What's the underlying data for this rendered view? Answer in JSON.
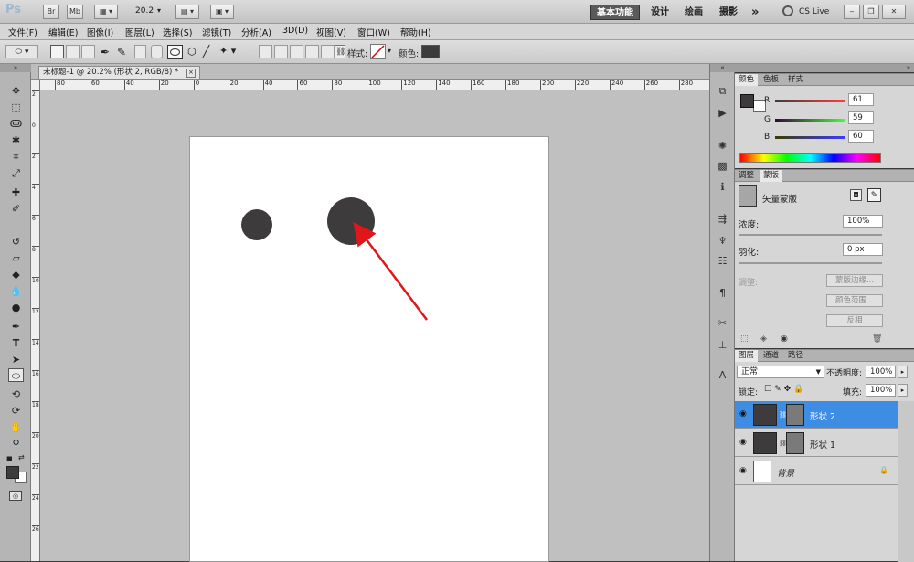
{
  "app": {
    "logo": "Ps",
    "bridge_btn": "Br",
    "minibridge_btn": "Mb",
    "zoom": "20.2",
    "workspaces": [
      "基本功能",
      "设计",
      "绘画",
      "摄影"
    ],
    "more": "»",
    "cslive": "CS Live"
  },
  "menus": [
    "文件(F)",
    "编辑(E)",
    "图像(I)",
    "图层(L)",
    "选择(S)",
    "滤镜(T)",
    "分析(A)",
    "3D(D)",
    "视图(V)",
    "窗口(W)",
    "帮助(H)"
  ],
  "options": {
    "style_label": "样式:",
    "color_label": "颜色:",
    "fill_color": "#3d3b3c"
  },
  "document": {
    "tab_title": "未标题-1 @ 20.2% (形状 2, RGB/8) *",
    "close": "×",
    "ruler_h": [
      "80",
      "60",
      "40",
      "20",
      "0",
      "20",
      "40",
      "60",
      "80",
      "100",
      "120",
      "140",
      "160",
      "180",
      "200",
      "220",
      "240",
      "260",
      "280"
    ],
    "ruler_v": [
      "2",
      "0",
      "2",
      "4",
      "6",
      "8",
      "10",
      "12",
      "14",
      "16",
      "18",
      "20",
      "22",
      "24",
      "26"
    ]
  },
  "color_panel": {
    "tabs": [
      "颜色",
      "色板",
      "样式"
    ],
    "r_label": "R",
    "r_value": "61",
    "g_label": "G",
    "g_value": "59",
    "b_label": "B",
    "b_value": "60",
    "fg_color": "#3d3b3c"
  },
  "masks_panel": {
    "tabs": [
      "调整",
      "蒙版"
    ],
    "mask_title": "矢量蒙版",
    "density_label": "浓度:",
    "density_value": "100%",
    "feather_label": "羽化:",
    "feather_value": "0 px",
    "refine_label": "调整:",
    "btn_edge": "蒙版边缘...",
    "btn_color_range": "颜色范围...",
    "btn_invert": "反相"
  },
  "layers_panel": {
    "tabs": [
      "图层",
      "通道",
      "路径"
    ],
    "blend_mode": "正常",
    "opacity_label": "不透明度:",
    "opacity_value": "100%",
    "lock_label": "锁定:",
    "fill_label": "填充:",
    "fill_value": "100%",
    "layers": [
      {
        "name": "形状 2",
        "selected": true
      },
      {
        "name": "形状 1",
        "selected": false
      },
      {
        "name": "背景",
        "selected": false
      }
    ]
  }
}
